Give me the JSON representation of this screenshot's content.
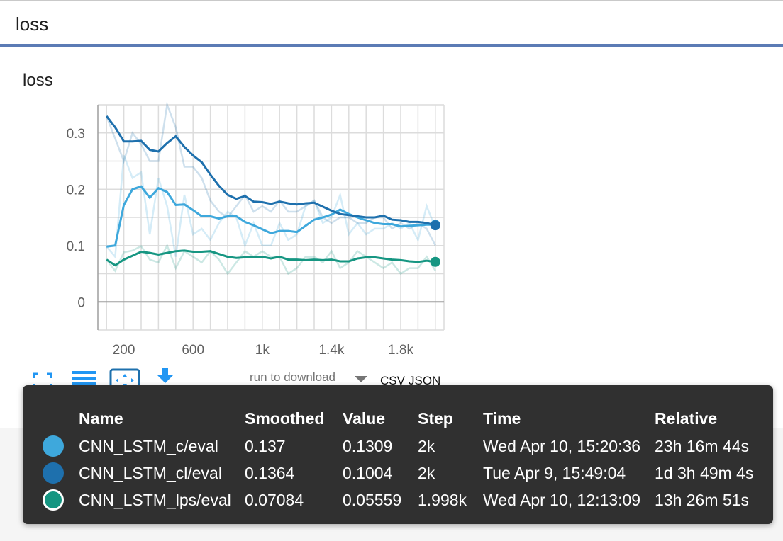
{
  "header": {
    "title": "loss"
  },
  "chart_data": {
    "type": "line",
    "title": "loss",
    "xlabel": "",
    "ylabel": "",
    "xlim": [
      50,
      2050
    ],
    "ylim": [
      -0.05,
      0.35
    ],
    "x_ticks": [
      200,
      600,
      1000,
      1400,
      1800
    ],
    "x_tick_labels": [
      "200",
      "600",
      "1k",
      "1.4k",
      "1.8k"
    ],
    "y_ticks": [
      0,
      0.1,
      0.2,
      0.3
    ],
    "y_tick_labels": [
      "0",
      "0.1",
      "0.2",
      "0.3"
    ],
    "grid": true,
    "x": [
      100,
      150,
      200,
      250,
      300,
      350,
      400,
      450,
      500,
      550,
      600,
      650,
      700,
      750,
      800,
      850,
      900,
      950,
      1000,
      1050,
      1100,
      1150,
      1200,
      1250,
      1300,
      1350,
      1400,
      1450,
      1500,
      1550,
      1600,
      1650,
      1700,
      1750,
      1800,
      1850,
      1900,
      1950,
      2000
    ],
    "series": [
      {
        "name": "CNN_LSTM_c/eval",
        "color": "#3ea8dc",
        "values": [
          0.098,
          0.1,
          0.172,
          0.2,
          0.205,
          0.185,
          0.202,
          0.195,
          0.172,
          0.173,
          0.163,
          0.152,
          0.152,
          0.148,
          0.152,
          0.152,
          0.142,
          0.136,
          0.129,
          0.122,
          0.126,
          0.126,
          0.124,
          0.135,
          0.146,
          0.15,
          0.155,
          0.164,
          0.156,
          0.15,
          0.145,
          0.14,
          0.138,
          0.138,
          0.134,
          0.135,
          0.136,
          0.137,
          0.137
        ],
        "raw_values": [
          0.098,
          0.08,
          0.26,
          0.22,
          0.23,
          0.12,
          0.22,
          0.17,
          0.08,
          0.19,
          0.12,
          0.13,
          0.11,
          0.14,
          0.16,
          0.15,
          0.1,
          0.14,
          0.1,
          0.1,
          0.14,
          0.11,
          0.12,
          0.17,
          0.18,
          0.14,
          0.15,
          0.19,
          0.12,
          0.14,
          0.12,
          0.13,
          0.13,
          0.14,
          0.13,
          0.14,
          0.11,
          0.17,
          0.131
        ]
      },
      {
        "name": "CNN_LSTM_cl/eval",
        "color": "#1e70ad",
        "values": [
          0.33,
          0.31,
          0.285,
          0.285,
          0.286,
          0.27,
          0.267,
          0.282,
          0.294,
          0.275,
          0.26,
          0.248,
          0.226,
          0.206,
          0.19,
          0.183,
          0.188,
          0.178,
          0.177,
          0.174,
          0.178,
          0.175,
          0.173,
          0.175,
          0.176,
          0.169,
          0.162,
          0.156,
          0.154,
          0.152,
          0.15,
          0.15,
          0.153,
          0.146,
          0.145,
          0.142,
          0.142,
          0.14,
          0.136
        ],
        "raw_values": [
          0.33,
          0.29,
          0.25,
          0.3,
          0.28,
          0.25,
          0.25,
          0.35,
          0.31,
          0.24,
          0.24,
          0.22,
          0.18,
          0.16,
          0.15,
          0.17,
          0.19,
          0.16,
          0.17,
          0.16,
          0.18,
          0.16,
          0.16,
          0.17,
          0.18,
          0.15,
          0.14,
          0.15,
          0.15,
          0.14,
          0.14,
          0.15,
          0.15,
          0.13,
          0.14,
          0.13,
          0.14,
          0.13,
          0.1004
        ]
      },
      {
        "name": "CNN_LSTM_lps/eval",
        "color": "#169682",
        "values": [
          0.075,
          0.065,
          0.075,
          0.082,
          0.089,
          0.087,
          0.084,
          0.087,
          0.09,
          0.091,
          0.089,
          0.089,
          0.09,
          0.085,
          0.08,
          0.078,
          0.079,
          0.079,
          0.08,
          0.077,
          0.08,
          0.075,
          0.075,
          0.074,
          0.075,
          0.074,
          0.075,
          0.072,
          0.072,
          0.077,
          0.079,
          0.079,
          0.077,
          0.075,
          0.074,
          0.072,
          0.071,
          0.073,
          0.071
        ],
        "raw_values": [
          0.075,
          0.055,
          0.088,
          0.091,
          0.099,
          0.075,
          0.07,
          0.1,
          0.06,
          0.09,
          0.08,
          0.07,
          0.09,
          0.075,
          0.05,
          0.07,
          0.09,
          0.08,
          0.09,
          0.08,
          0.08,
          0.05,
          0.06,
          0.08,
          0.08,
          0.07,
          0.09,
          0.06,
          0.07,
          0.09,
          0.08,
          0.07,
          0.06,
          0.07,
          0.05,
          0.06,
          0.06,
          0.08,
          0.05559
        ]
      }
    ]
  },
  "toolbar": {
    "fit_icon": "fit-to-data-icon",
    "lines_icon": "toggle-lines-icon",
    "zoom_icon": "zoom-icon",
    "download_icon": "download-icon",
    "download_label": "run to download",
    "csv_label": "CSV",
    "json_label": "JSON"
  },
  "tooltip": {
    "headers": {
      "name": "Name",
      "smoothed": "Smoothed",
      "value": "Value",
      "step": "Step",
      "time": "Time",
      "relative": "Relative"
    },
    "rows": [
      {
        "color": "#3ea8dc",
        "name": "CNN_LSTM_c/eval",
        "smoothed": "0.137",
        "value": "0.1309",
        "step": "2k",
        "time": "Wed Apr 10, 15:20:36",
        "relative": "23h 16m 44s"
      },
      {
        "color": "#1e70ad",
        "name": "CNN_LSTM_cl/eval",
        "smoothed": "0.1364",
        "value": "0.1004",
        "step": "2k",
        "time": "Tue Apr 9, 15:49:04",
        "relative": "1d 3h 49m 4s"
      },
      {
        "color": "#169682",
        "name": "CNN_LSTM_lps/eval",
        "smoothed": "0.07084",
        "value": "0.05559",
        "step": "1.998k",
        "time": "Wed Apr 10, 12:13:09",
        "relative": "13h 26m 51s"
      }
    ]
  }
}
